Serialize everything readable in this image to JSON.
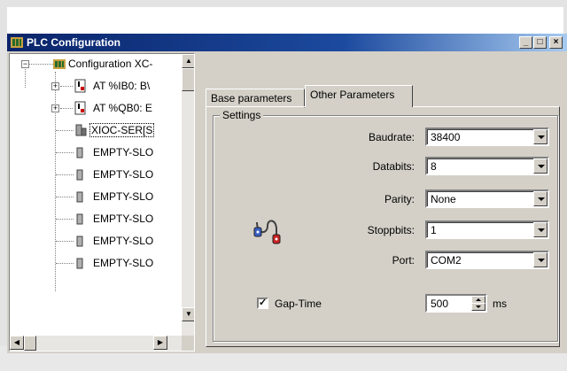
{
  "window": {
    "title": "PLC Configuration",
    "minimize": "_",
    "maximize": "□",
    "close": "×"
  },
  "tree": {
    "root": {
      "label": "Configuration XC-",
      "expander": "−"
    },
    "items": [
      {
        "label": "AT %IB0: B\\",
        "expander": "+"
      },
      {
        "label": "AT %QB0: E",
        "expander": "+"
      },
      {
        "label": "XIOC-SER[S",
        "expander": ""
      },
      {
        "label": "EMPTY-SLO",
        "expander": ""
      },
      {
        "label": "EMPTY-SLO",
        "expander": ""
      },
      {
        "label": "EMPTY-SLO",
        "expander": ""
      },
      {
        "label": "EMPTY-SLO",
        "expander": ""
      },
      {
        "label": "EMPTY-SLO",
        "expander": ""
      },
      {
        "label": "EMPTY-SLO",
        "expander": ""
      }
    ]
  },
  "tabs": [
    {
      "label": "Base parameters"
    },
    {
      "label": "Other Parameters"
    }
  ],
  "settings": {
    "group_title": "Settings",
    "baudrate": {
      "label": "Baudrate:",
      "value": "38400"
    },
    "databits": {
      "label": "Databits:",
      "value": "8"
    },
    "parity": {
      "label": "Parity:",
      "value": "None"
    },
    "stoppbits": {
      "label": "Stoppbits:",
      "value": "1"
    },
    "port": {
      "label": "Port:",
      "value": "COM2"
    },
    "gap_time": {
      "label": "Gap-Time",
      "checked": true,
      "check_mark": "✓",
      "value": "500",
      "unit": "ms"
    }
  }
}
